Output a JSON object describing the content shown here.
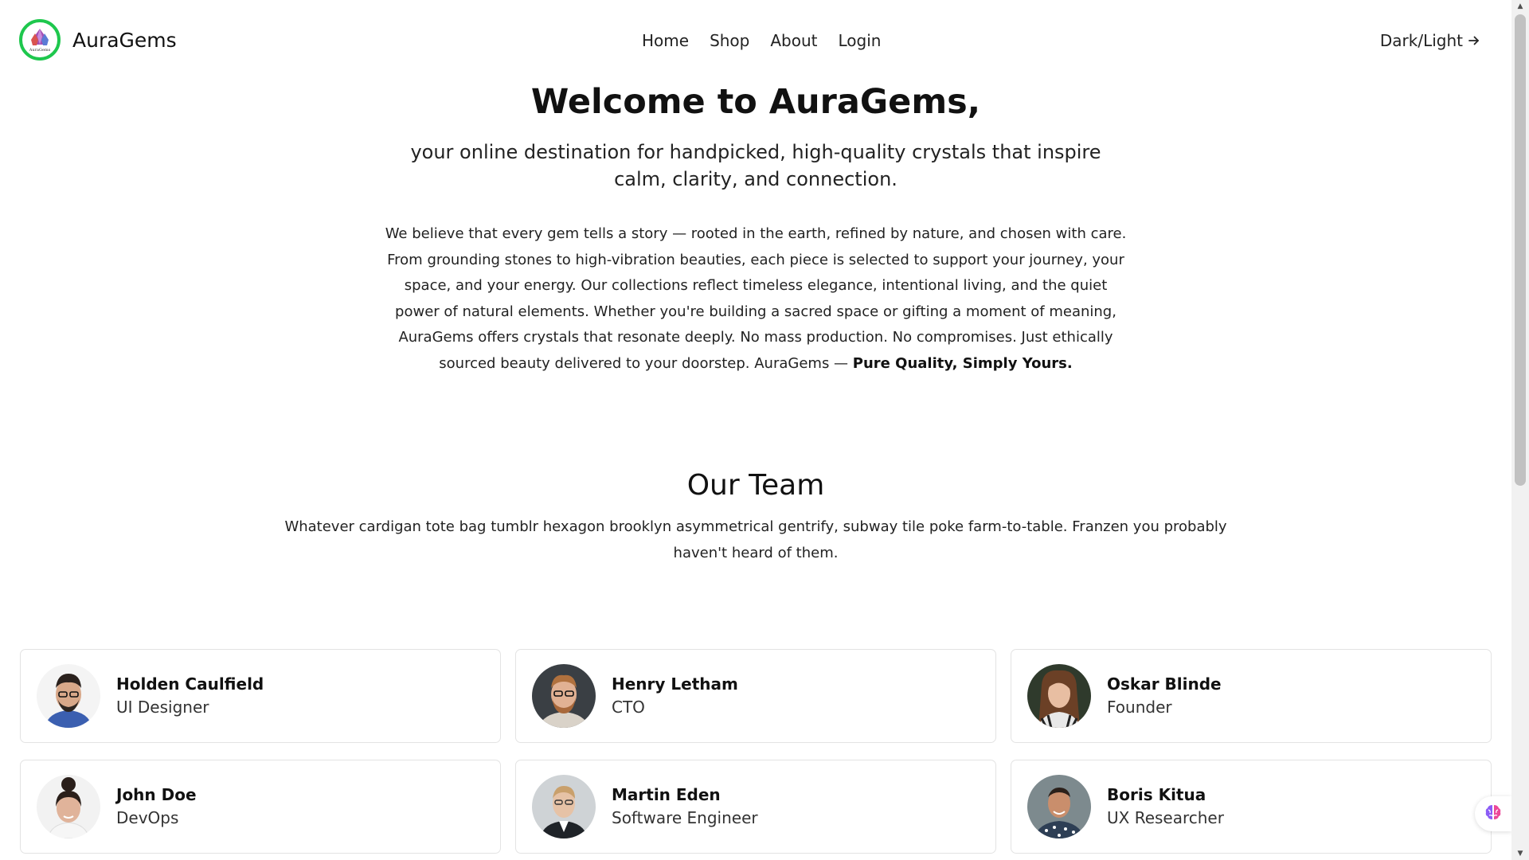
{
  "header": {
    "brand_name": "AuraGems",
    "logo_text": "AuraGems",
    "nav": [
      {
        "label": "Home"
      },
      {
        "label": "Shop"
      },
      {
        "label": "About"
      },
      {
        "label": "Login"
      }
    ],
    "theme_toggle_label": "Dark/Light"
  },
  "hero": {
    "title": "Welcome to AuraGems,",
    "lead": "your online destination for handpicked, high-quality crystals that inspire calm, clarity, and connection.",
    "body": "We believe that every gem tells a story — rooted in the earth, refined by nature, and chosen with care. From grounding stones to high-vibration beauties, each piece is selected to support your journey, your space, and your energy. Our collections reflect timeless elegance, intentional living, and the quiet power of natural elements. Whether you're building a sacred space or gifting a moment of meaning, AuraGems offers crystals that resonate deeply. No mass production. No compromises. Just ethically sourced beauty delivered to your doorstep. AuraGems —",
    "tagline": "Pure Quality, Simply Yours."
  },
  "team": {
    "title": "Our Team",
    "description": "Whatever cardigan tote bag tumblr hexagon brooklyn asymmetrical gentrify, subway tile poke farm-to-table. Franzen you probably haven't heard of them.",
    "members": [
      {
        "name": "Holden Caulfield",
        "role": "UI Designer"
      },
      {
        "name": "Henry Letham",
        "role": "CTO"
      },
      {
        "name": "Oskar Blinde",
        "role": "Founder"
      },
      {
        "name": "John Doe",
        "role": "DevOps"
      },
      {
        "name": "Martin Eden",
        "role": "Software Engineer"
      },
      {
        "name": "Boris Kitua",
        "role": "UX Researcher"
      }
    ]
  },
  "icons": {
    "logo": "auragems-crystal-logo",
    "toggle": "arrow-right-icon",
    "widget": "brain-icon",
    "avatars": "person-photo"
  },
  "colors": {
    "logo_ring": "#1ec74d",
    "card_border": "#e3e3e3",
    "text": "#111111",
    "widget_accent": "#8b5cf6"
  }
}
